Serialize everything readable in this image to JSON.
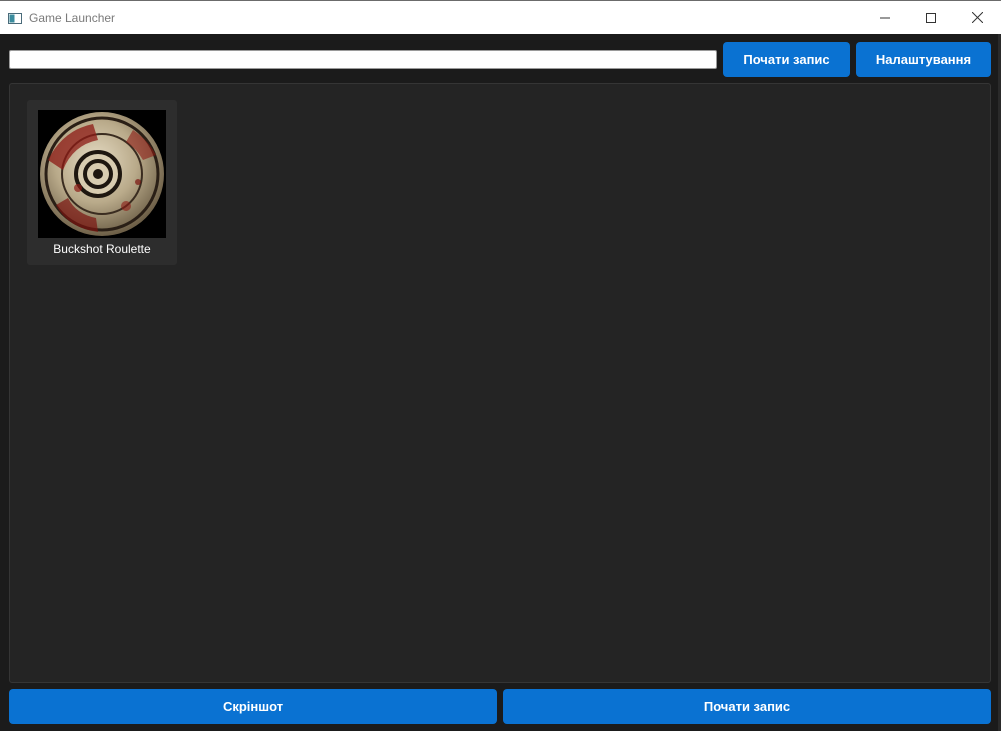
{
  "window": {
    "title": "Game Launcher",
    "icons": {
      "app": "app-window-icon",
      "minimize": "minimize-icon",
      "maximize": "maximize-icon",
      "close": "close-icon"
    }
  },
  "toolbar": {
    "search_value": "",
    "record_label": "Почати запис",
    "settings_label": "Налаштування"
  },
  "library": {
    "games": [
      {
        "name": "Buckshot Roulette",
        "cover_icon": "shotgun-shell-cover-icon"
      }
    ]
  },
  "footer": {
    "screenshot_label": "Скріншот",
    "record_label": "Почати запис"
  },
  "colors": {
    "accent": "#0a72d2",
    "background": "#1b1b1b",
    "panel": "#242424",
    "card": "#2d2d2d",
    "titlebar": "#ffffff"
  }
}
